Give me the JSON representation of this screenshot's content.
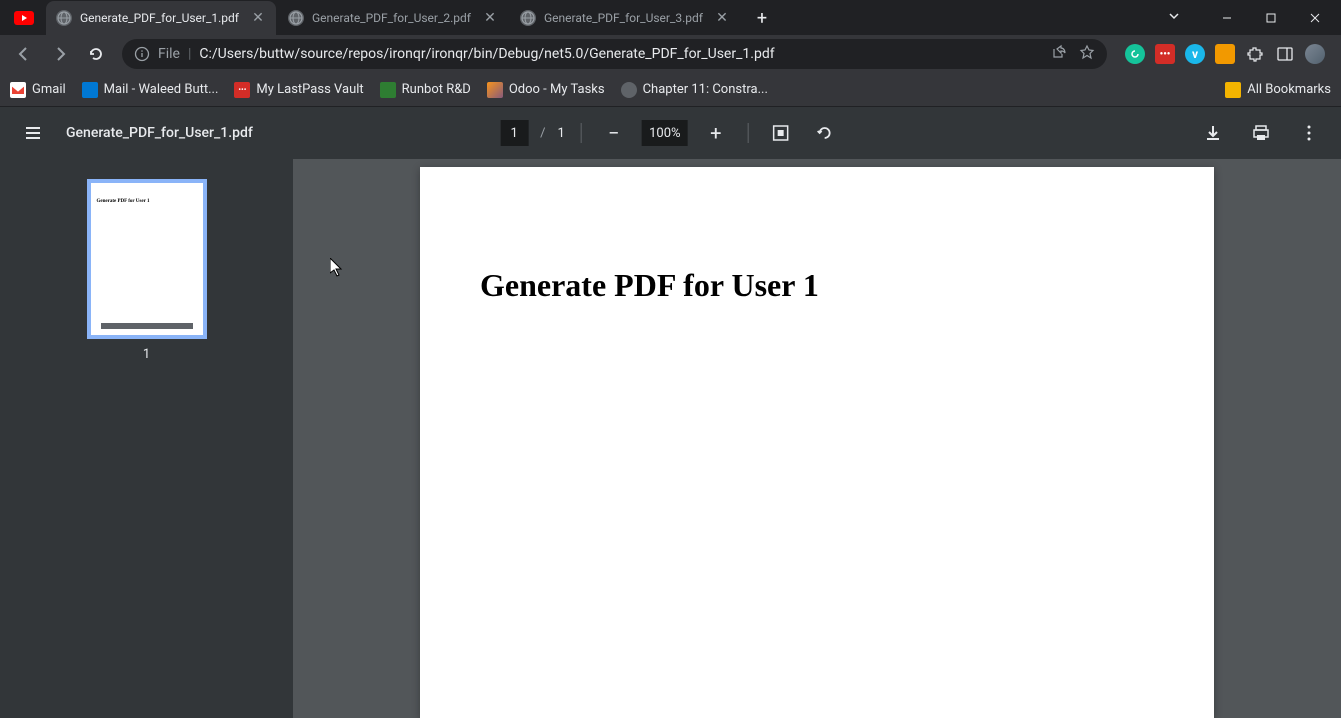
{
  "tabs": [
    {
      "title": "Generate_PDF_for_User_1.pdf",
      "active": true
    },
    {
      "title": "Generate_PDF_for_User_2.pdf",
      "active": false
    },
    {
      "title": "Generate_PDF_for_User_3.pdf",
      "active": false
    }
  ],
  "url": {
    "file_label": "File",
    "path": "C:/Users/buttw/source/repos/ironqr/ironqr/bin/Debug/net5.0/Generate_PDF_for_User_1.pdf"
  },
  "bookmarks": [
    {
      "label": "Gmail",
      "color": "#ea4335"
    },
    {
      "label": "Mail - Waleed Butt...",
      "color": "#0078d4"
    },
    {
      "label": "My LastPass Vault",
      "color": "#d32d27"
    },
    {
      "label": "Runbot R&D",
      "color": "#2e7d32"
    },
    {
      "label": "Odoo - My Tasks",
      "color": "#875a7b"
    },
    {
      "label": "Chapter 11: Constra...",
      "color": "#5f6368"
    }
  ],
  "bookmarks_all": "All Bookmarks",
  "pdf": {
    "filename": "Generate_PDF_for_User_1.pdf",
    "current_page": "1",
    "total_pages": "1",
    "zoom": "100%",
    "thumbnail_label": "1",
    "page_heading": "Generate PDF for User 1"
  }
}
